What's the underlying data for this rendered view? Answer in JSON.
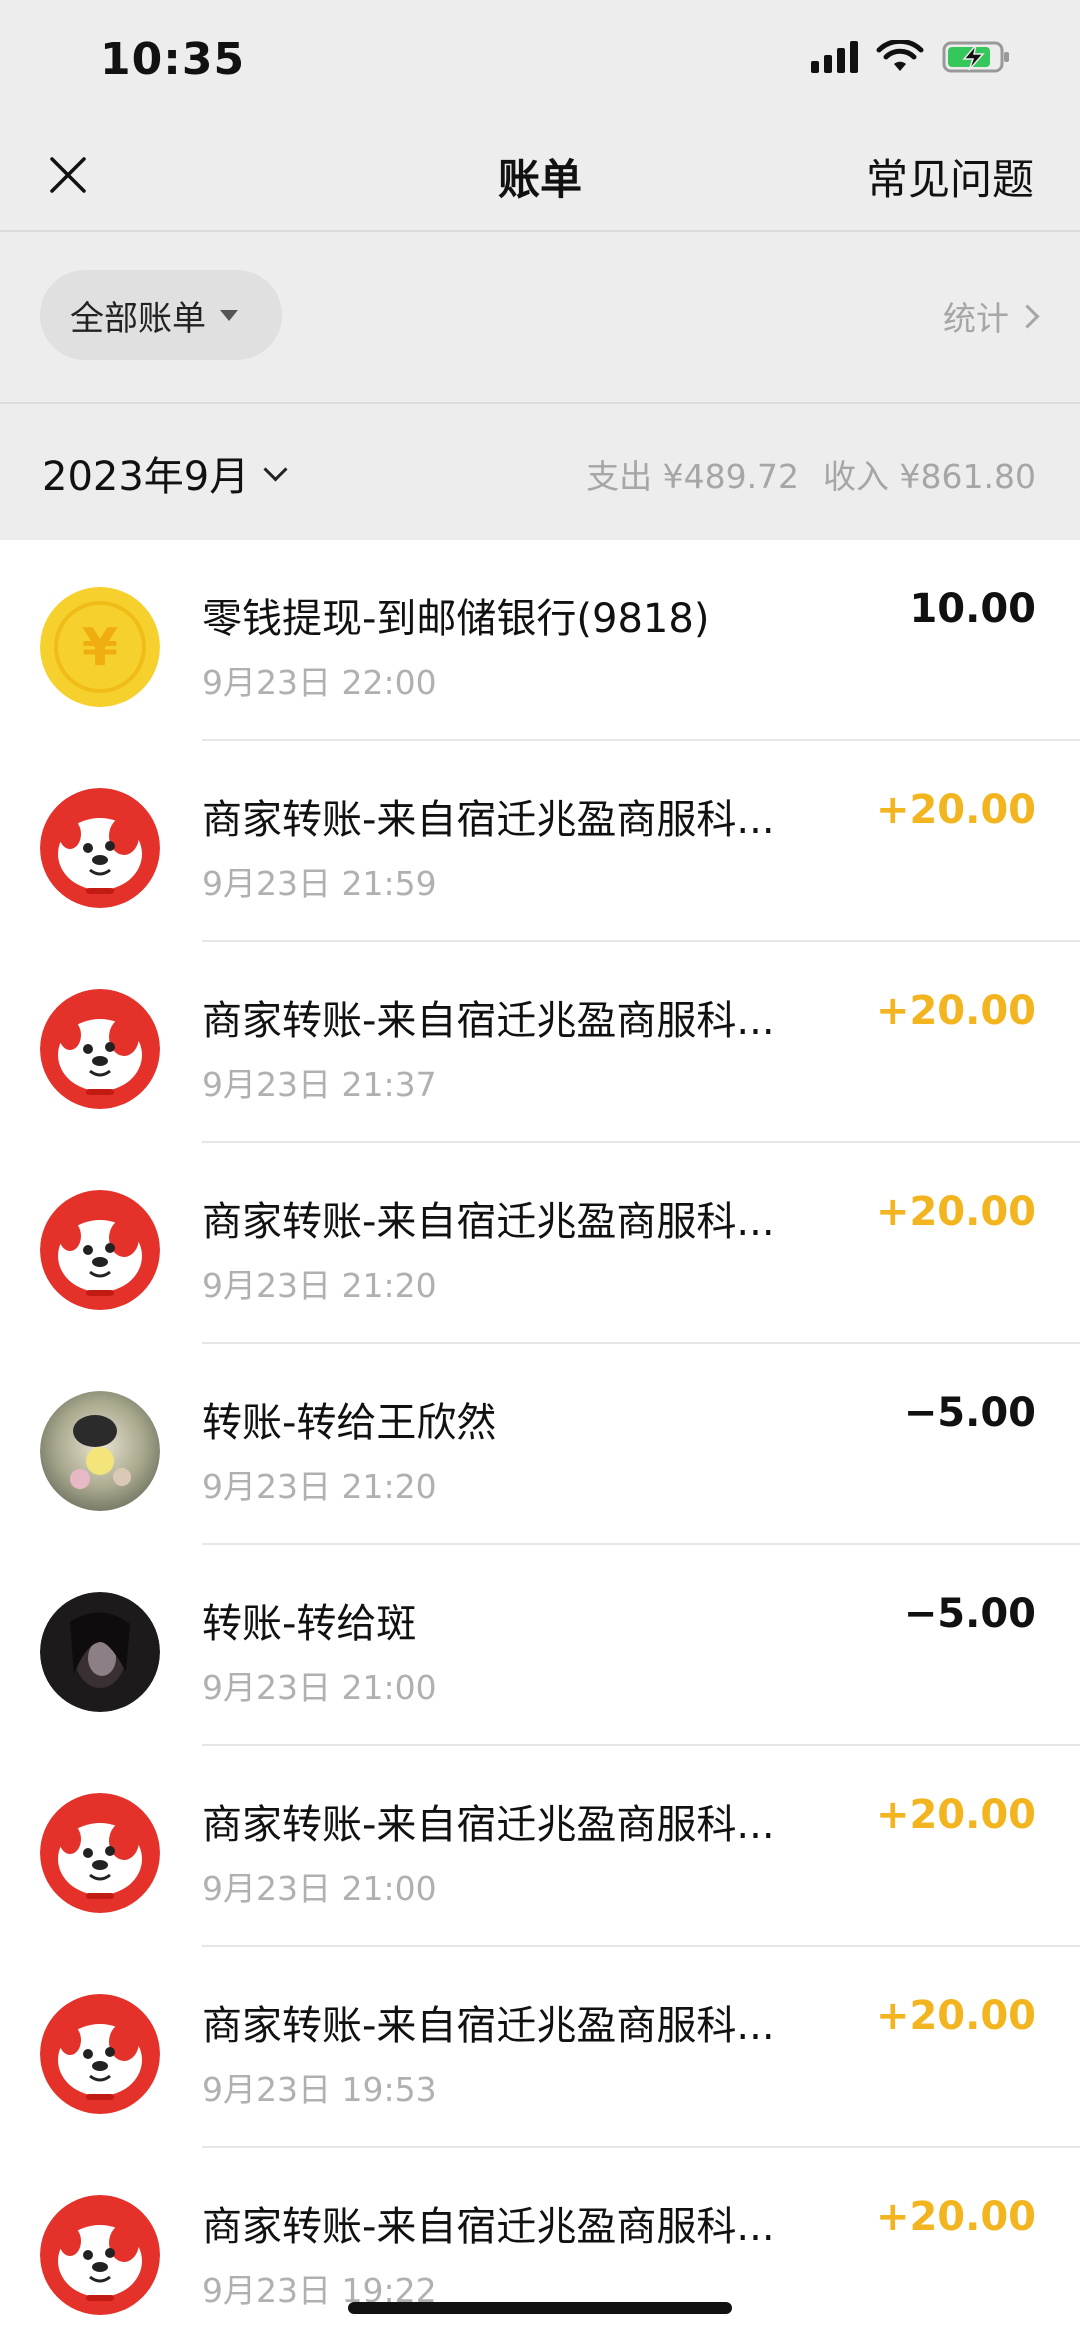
{
  "status_bar": {
    "time": "10:35"
  },
  "nav": {
    "title": "账单",
    "right_link": "常见问题"
  },
  "filter": {
    "label": "全部账单",
    "stats_label": "统计"
  },
  "month_bar": {
    "month": "2023年9月",
    "expense": "支出 ¥489.72",
    "income": "收入 ¥861.80"
  },
  "colors": {
    "income": "#f3b51f",
    "jd_red": "#e4322b",
    "coin_yellow": "#f6d02c"
  },
  "transactions": [
    {
      "title": "零钱提现-到邮储银行(9818)",
      "time": "9月23日 22:00",
      "amount": "10.00",
      "type": "neutral",
      "icon": "coin-icon"
    },
    {
      "title": "商家转账-来自宿迁兆盈商服科...",
      "time": "9月23日 21:59",
      "amount": "+20.00",
      "type": "income",
      "icon": "jd-dog-avatar"
    },
    {
      "title": "商家转账-来自宿迁兆盈商服科...",
      "time": "9月23日 21:37",
      "amount": "+20.00",
      "type": "income",
      "icon": "jd-dog-avatar"
    },
    {
      "title": "商家转账-来自宿迁兆盈商服科...",
      "time": "9月23日 21:20",
      "amount": "+20.00",
      "type": "income",
      "icon": "jd-dog-avatar"
    },
    {
      "title": "转账-转给王欣然",
      "time": "9月23日 21:20",
      "amount": "−5.00",
      "type": "expense",
      "icon": "photo-avatar-light"
    },
    {
      "title": "转账-转给斑",
      "time": "9月23日 21:00",
      "amount": "−5.00",
      "type": "expense",
      "icon": "photo-avatar-dark"
    },
    {
      "title": "商家转账-来自宿迁兆盈商服科...",
      "time": "9月23日 21:00",
      "amount": "+20.00",
      "type": "income",
      "icon": "jd-dog-avatar"
    },
    {
      "title": "商家转账-来自宿迁兆盈商服科...",
      "time": "9月23日 19:53",
      "amount": "+20.00",
      "type": "income",
      "icon": "jd-dog-avatar"
    },
    {
      "title": "商家转账-来自宿迁兆盈商服科...",
      "time": "9月23日 19:22",
      "amount": "+20.00",
      "type": "income",
      "icon": "jd-dog-avatar"
    }
  ]
}
